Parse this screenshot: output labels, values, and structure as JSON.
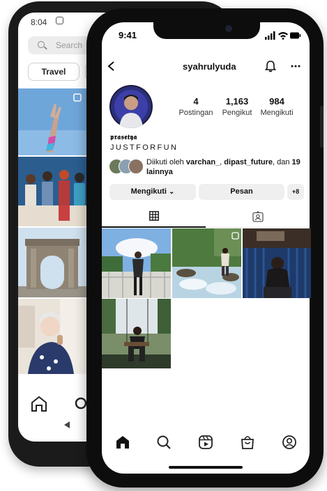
{
  "back_phone": {
    "status_time": "8:04",
    "search_placeholder": "Search",
    "chip_label": "Travel"
  },
  "front_phone": {
    "status_time": "9:41",
    "header": {
      "username": "syahrulyuda"
    },
    "stats": [
      {
        "value": "4",
        "label": "Postingan"
      },
      {
        "value": "1,163",
        "label": "Pengikut"
      },
      {
        "value": "984",
        "label": "Mengikuti"
      }
    ],
    "bio": {
      "name": "𝖕𝖗𝖆𝖘𝖊𝖙𝖞𝖆",
      "tagline": "JUSTFORFUN"
    },
    "followed_by": {
      "prefix": "Diikuti oleh ",
      "user1": "varchan_",
      "sep": ", ",
      "user2": "dipast_future",
      "middle": ", dan ",
      "rest": "19 lainnya"
    },
    "buttons": {
      "following": "Mengikuti",
      "following_caret": "⌄",
      "message": "Pesan",
      "add_person": "+8"
    },
    "tabs": [
      "grid-icon",
      "tagged-icon"
    ],
    "bottom_nav": [
      "home-icon",
      "search-icon",
      "reels-icon",
      "shop-icon",
      "profile-icon"
    ]
  }
}
